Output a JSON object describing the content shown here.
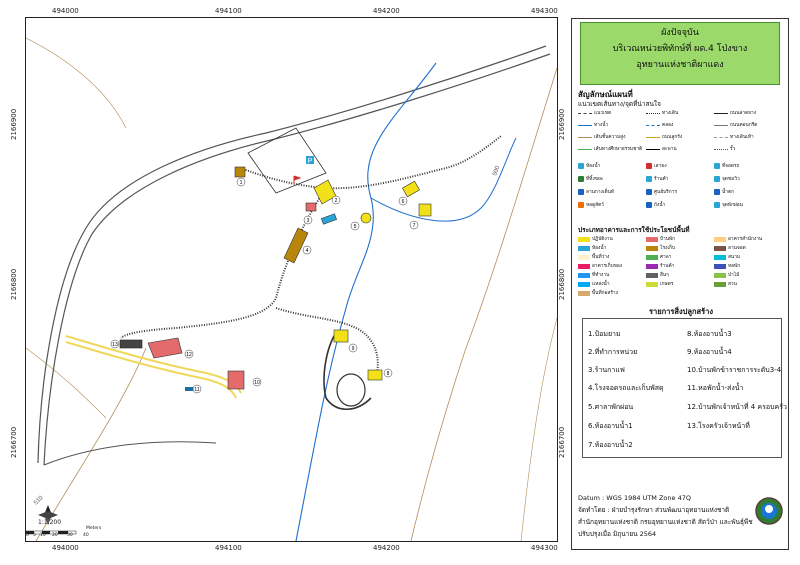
{
  "title": {
    "line1": "ผังปัจจุบัน",
    "line2": "บริเวณหน่วยพิทักษ์ที่ ผด.4 โป่งขาง",
    "line3": "อุทยานแห่งชาติผาแดง"
  },
  "grid": {
    "top_x_labels": [
      "494000",
      "494100",
      "494200",
      "494300"
    ],
    "bottom_x_labels": [
      "494000",
      "494100",
      "494200",
      "494300"
    ],
    "left_y_labels": [
      "2166900",
      "2166800",
      "2166700"
    ],
    "right_y_labels": [
      "2166900",
      "2166800",
      "2166700"
    ]
  },
  "map": {
    "contour_labels": [
      "500",
      "510"
    ],
    "scale_label": "1:1,200",
    "scale_ticks": [
      "0",
      "5",
      "10",
      "20",
      "30",
      "40"
    ],
    "scale_unit": "Meters",
    "building_numbers": [
      "1",
      "2",
      "3",
      "4",
      "5",
      "6",
      "7",
      "8",
      "9",
      "10",
      "11",
      "12",
      "13"
    ],
    "parking_icon": "P",
    "colors": {
      "road": "#555555",
      "path": "#333333",
      "stream": "#1f6fcf",
      "contour": "#b08d5a",
      "yellow_building": "#f2e019",
      "red_building": "#e36b6b",
      "brown_building": "#b8860b",
      "cyan_building": "#2aa5d6",
      "dark_building": "#444444",
      "yellow_route": "#f0d85a"
    }
  },
  "legend": {
    "heading": "สัญลักษณ์แผนที่",
    "subheading": "แนวเขตเส้นทาง/จุดที่น่าสนใจ",
    "line_items": [
      {
        "label": "แนวเขต",
        "color": "#444444",
        "style": "dashed"
      },
      {
        "label": "ทางเดิน",
        "color": "#333333",
        "style": "dotted"
      },
      {
        "label": "ถนนลาดยาง",
        "color": "#222222",
        "style": "solid"
      },
      {
        "label": "ทางน้ำ",
        "color": "#1f6fcf",
        "style": "solid"
      },
      {
        "label": "คลอง",
        "color": "#1f6fcf",
        "style": "dashed"
      },
      {
        "label": "ถนนคอนกรีต",
        "color": "#777777",
        "style": "solid"
      },
      {
        "label": "เส้นชั้นความสูง",
        "color": "#b08d5a",
        "style": "solid"
      },
      {
        "label": "ถนนลูกรัง",
        "color": "#d4a017",
        "style": "solid"
      },
      {
        "label": "ทางเดินเท้า",
        "color": "#999999",
        "style": "dashed"
      },
      {
        "label": "เส้นทางศึกษาธรรมชาติ",
        "color": "#4caf50",
        "style": "solid"
      },
      {
        "label": "สะพาน",
        "color": "#000000",
        "style": "solid"
      },
      {
        "label": "รั้ว",
        "color": "#555555",
        "style": "dotted"
      }
    ],
    "point_items": [
      {
        "label": "ห้องน้ำ",
        "icon": "toilet-icon",
        "color": "#2aa5d6"
      },
      {
        "label": "เสาธง",
        "icon": "flag-icon",
        "color": "#d32f2f"
      },
      {
        "label": "ที่จอดรถ",
        "icon": "parking-icon",
        "color": "#2aa5d6"
      },
      {
        "label": "ที่ทิ้งขยะ",
        "icon": "trash-icon",
        "color": "#2e7d32"
      },
      {
        "label": "ร้านค้า",
        "icon": "shop-icon",
        "color": "#2aa5d6"
      },
      {
        "label": "จุดชมวิว",
        "icon": "viewpoint-icon",
        "color": "#2aa5d6"
      },
      {
        "label": "ลานกางเต็นท์",
        "icon": "tent-icon",
        "color": "#1565c0"
      },
      {
        "label": "ศูนย์บริการ",
        "icon": "info-icon",
        "color": "#1565c0"
      },
      {
        "label": "น้ำตก",
        "icon": "waterfall-icon",
        "color": "#1565c0"
      },
      {
        "label": "หอดูสัตว์",
        "icon": "tower-icon",
        "color": "#ef6c00"
      },
      {
        "label": "ถังน้ำ",
        "icon": "water-tank-icon",
        "color": "#1565c0"
      },
      {
        "label": "จุดพักผ่อน",
        "icon": "rest-icon",
        "color": "#2aa5d6"
      }
    ],
    "landuse_heading": "ประเภทอาคารและการใช้ประโยชน์พื้นที่",
    "landuse_items": [
      {
        "label": "ปฏิบัติงาน",
        "color": "#f2e019"
      },
      {
        "label": "บ้านพัก",
        "color": "#e36b6b"
      },
      {
        "label": "อาคารสำนักงาน",
        "color": "#ffcc80"
      },
      {
        "label": "ห้องน้ำ",
        "color": "#2aa5d6"
      },
      {
        "label": "โรงเก็บ",
        "color": "#b8860b"
      },
      {
        "label": "ลานจอด",
        "color": "#795548"
      },
      {
        "label": "พื้นที่ว่าง",
        "color": "#fff3cd"
      },
      {
        "label": "ศาลา",
        "color": "#4caf50"
      },
      {
        "label": "สนาม",
        "color": "#00bcd4"
      },
      {
        "label": "อาคารเก็บของ",
        "color": "#e91e63"
      },
      {
        "label": "ร้านค้า",
        "color": "#9c27b0"
      },
      {
        "label": "หอพัก",
        "color": "#3f51b5"
      },
      {
        "label": "ที่ทำงาน",
        "color": "#2196f3"
      },
      {
        "label": "อื่นๆ",
        "color": "#616161"
      },
      {
        "label": "ป่าไม้",
        "color": "#8bc34a"
      },
      {
        "label": "แหล่งน้ำ",
        "color": "#03a9f4"
      },
      {
        "label": "เกษตร",
        "color": "#cddc39"
      },
      {
        "label": "สวน",
        "color": "#689f38"
      },
      {
        "label": "พื้นที่ก่อสร้าง",
        "color": "#d7a86e"
      }
    ]
  },
  "building_list": {
    "heading": "รายการสิ่งปลูกสร้าง",
    "left_column": [
      "1.ป้อมยาม",
      "2.ที่ทำการหน่วย",
      "3.ร้านกาแฟ",
      "4.โรงจอดรถและเก็บพัสดุ",
      "5.ศาลาพักผ่อน",
      "6.ห้องอาบน้ำ1",
      "7.ห้องอาบน้ำ2"
    ],
    "right_column": [
      "8.ห้องอาบน้ำ3",
      "9.ห้องอาบน้ำ4",
      "10.บ้านพักข้าราชการระดับ3-4",
      "11.หอพักน้ำ-ส่งน้ำ",
      "12.บ้านพักเจ้าหน้าที่ 4 ครอบครัว",
      "13.โรงครัวเจ้าหน้าที่"
    ]
  },
  "footer": {
    "datum": "Datum : WGS 1984 UTM Zone 47Q",
    "prepared_by_line1": "จัดทำโดย : ฝ่ายบำรุงรักษา ส่วนพัฒนาอุทยานแห่งชาติ",
    "prepared_by_line2": "สำนักอุทยานแห่งชาติ กรมอุทยานแห่งชาติ สัตว์ป่า และพันธุ์พืช",
    "updated": "ปรับปรุงเมื่อ มิถุนายน 2564"
  }
}
